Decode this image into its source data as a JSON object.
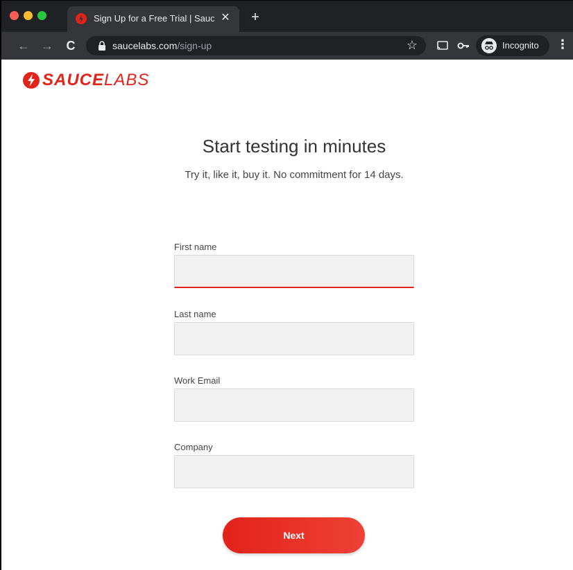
{
  "browser": {
    "tab_title": "Sign Up for a Free Trial | Sauce",
    "tab_close": "✕",
    "new_tab": "+",
    "url_host": "saucelabs.com",
    "url_path": "/sign-up",
    "incognito_label": "Incognito"
  },
  "page": {
    "logo_bold": "SAUCE",
    "logo_light": "LABS",
    "heading": "Start testing in minutes",
    "subheading": "Try it, like it, buy it. No commitment for 14 days.",
    "fields": [
      {
        "label": "First name",
        "value": ""
      },
      {
        "label": "Last name",
        "value": ""
      },
      {
        "label": "Work Email",
        "value": ""
      },
      {
        "label": "Company",
        "value": ""
      }
    ],
    "next_label": "Next"
  },
  "colors": {
    "brand": "#e2231a",
    "chrome_dark": "#202124",
    "chrome_toolbar": "#35363a"
  }
}
